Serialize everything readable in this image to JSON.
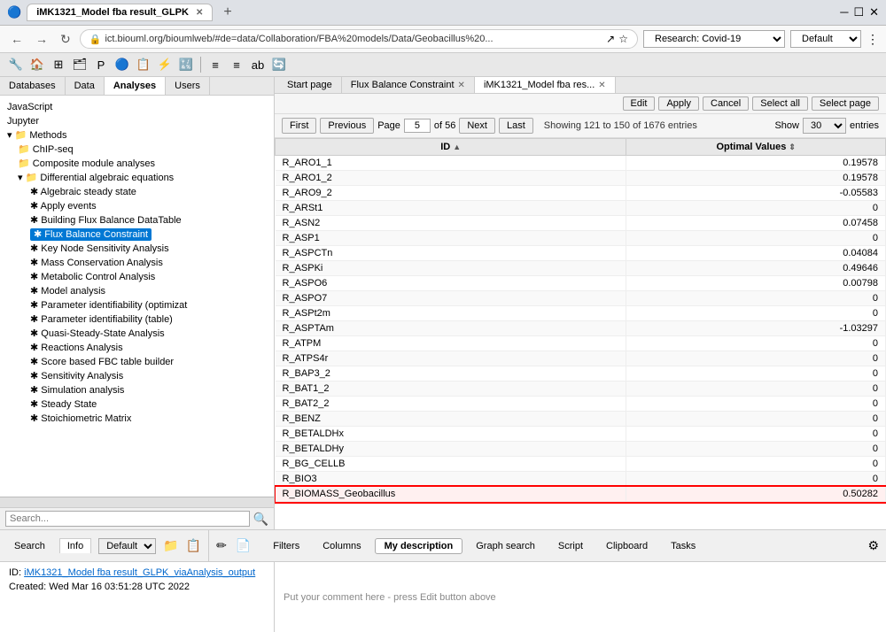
{
  "browser": {
    "tabs": [
      {
        "label": "iMK1321_Model fba result_GLPK",
        "active": true
      },
      {
        "label": "+",
        "active": false
      }
    ],
    "address": "ict.biouml.org/bioumlweb/#de=data/Collaboration/FBA%20models/Data/Geobacillus%20...",
    "research_label": "Research: Covid-19",
    "default_label": "Default"
  },
  "left_panel": {
    "tabs": [
      "Databases",
      "Data",
      "Analyses",
      "Users"
    ],
    "active_tab": "Analyses",
    "tree": [
      {
        "level": 1,
        "icon": "📄",
        "label": "JavaScript"
      },
      {
        "level": 1,
        "icon": "📄",
        "label": "Jupyter"
      },
      {
        "level": 1,
        "icon": "📁",
        "label": "Methods",
        "expanded": true
      },
      {
        "level": 2,
        "icon": "📁",
        "label": "ChIP-seq"
      },
      {
        "level": 2,
        "icon": "📁",
        "label": "Composite module analyses"
      },
      {
        "level": 2,
        "icon": "📁",
        "label": "Differential algebraic equations",
        "expanded": true
      },
      {
        "level": 3,
        "icon": "✱",
        "label": "Algebraic steady state"
      },
      {
        "level": 3,
        "icon": "✱",
        "label": "Apply events"
      },
      {
        "level": 3,
        "icon": "✱",
        "label": "Building Flux Balance DataTable"
      },
      {
        "level": 3,
        "icon": "✱",
        "label": "Flux Balance Constraint",
        "selected": true
      },
      {
        "level": 3,
        "icon": "✱",
        "label": "Key Node Sensitivity Analysis"
      },
      {
        "level": 3,
        "icon": "✱",
        "label": "Mass Conservation Analysis"
      },
      {
        "level": 3,
        "icon": "✱",
        "label": "Metabolic Control Analysis"
      },
      {
        "level": 3,
        "icon": "✱",
        "label": "Model analysis"
      },
      {
        "level": 3,
        "icon": "✱",
        "label": "Parameter identifiability (optimizat"
      },
      {
        "level": 3,
        "icon": "✱",
        "label": "Parameter identifiability (table)"
      },
      {
        "level": 3,
        "icon": "✱",
        "label": "Quasi-Steady-State Analysis"
      },
      {
        "level": 3,
        "icon": "✱",
        "label": "Reactions Analysis"
      },
      {
        "level": 3,
        "icon": "✱",
        "label": "Score based FBC table builder"
      },
      {
        "level": 3,
        "icon": "✱",
        "label": "Sensitivity Analysis"
      },
      {
        "level": 3,
        "icon": "✱",
        "label": "Simulation analysis"
      },
      {
        "level": 3,
        "icon": "✱",
        "label": "Steady State"
      },
      {
        "level": 3,
        "icon": "✱",
        "label": "Stoichiometric Matrix"
      }
    ]
  },
  "right_panel": {
    "tabs": [
      {
        "label": "Start page",
        "closeable": false
      },
      {
        "label": "Flux Balance Constraint",
        "closeable": true
      },
      {
        "label": "iMK1321_Model fba res...",
        "closeable": true,
        "active": true
      }
    ],
    "toolbar": {
      "first": "First",
      "previous": "Previous",
      "page_label": "Page",
      "page_value": "5",
      "of_label": "of 56",
      "next": "Next",
      "last": "Last",
      "showing": "Showing 121 to 150 of 1676 entries",
      "show_label": "Show",
      "show_value": "30",
      "entries_label": "entries"
    },
    "edit_bar": {
      "edit": "Edit",
      "apply": "Apply",
      "cancel": "Cancel",
      "select_all": "Select all",
      "select_page": "Select page"
    },
    "table": {
      "columns": [
        "ID",
        "Optimal Values"
      ],
      "rows": [
        {
          "id": "R_ARO1_1",
          "value": "0.19578"
        },
        {
          "id": "R_ARO1_2",
          "value": "0.19578"
        },
        {
          "id": "R_ARO9_2",
          "value": "-0.05583"
        },
        {
          "id": "R_ARSt1",
          "value": "0"
        },
        {
          "id": "R_ASN2",
          "value": "0.07458"
        },
        {
          "id": "R_ASP1",
          "value": "0"
        },
        {
          "id": "R_ASPCTn",
          "value": "0.04084"
        },
        {
          "id": "R_ASPKi",
          "value": "0.49646"
        },
        {
          "id": "R_ASPO6",
          "value": "0.00798"
        },
        {
          "id": "R_ASPO7",
          "value": "0"
        },
        {
          "id": "R_ASPt2m",
          "value": "0"
        },
        {
          "id": "R_ASPTAm",
          "value": "-1.03297"
        },
        {
          "id": "R_ATPM",
          "value": "0"
        },
        {
          "id": "R_ATPS4r",
          "value": "0"
        },
        {
          "id": "R_BAP3_2",
          "value": "0"
        },
        {
          "id": "R_BAT1_2",
          "value": "0"
        },
        {
          "id": "R_BAT2_2",
          "value": "0"
        },
        {
          "id": "R_BENZ",
          "value": "0"
        },
        {
          "id": "R_BETALDHx",
          "value": "0"
        },
        {
          "id": "R_BETALDHy",
          "value": "0"
        },
        {
          "id": "R_BG_CELLB",
          "value": "0"
        },
        {
          "id": "R_BIO3",
          "value": "0"
        },
        {
          "id": "R_BIOMASS_Geobacillus",
          "value": "0.50282",
          "highlighted": true
        }
      ]
    }
  },
  "bottom": {
    "left_tabs": [
      "Search",
      "Info"
    ],
    "active_left_tab": "Info",
    "default_label": "Default",
    "right_tabs": [
      "Filters",
      "Columns",
      "My description",
      "Graph search",
      "Script",
      "Clipboard",
      "Tasks"
    ],
    "active_right_tab": "My description",
    "description_placeholder": "Put your comment here - press Edit button above",
    "settings_icon": "⚙"
  },
  "info_panel": {
    "id_label": "ID:",
    "id_value": "iMK1321_Model fba result_GLPK_viaAnalysis_output",
    "created_label": "Created:",
    "created_value": "Wed Mar 16 03:51:28 UTC 2022"
  }
}
